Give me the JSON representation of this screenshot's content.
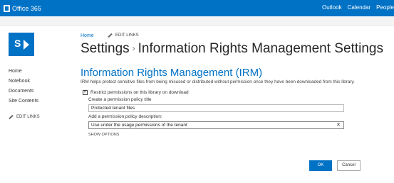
{
  "suite_bar": {
    "brand": "Office 365",
    "nav": [
      "Outlook",
      "Calendar",
      "People"
    ]
  },
  "breadcrumb": {
    "home": "Home",
    "edit_links": "EDIT LINKS"
  },
  "page_title": {
    "parent": "Settings",
    "separator": "›",
    "current": "Information Rights Management Settings"
  },
  "left_nav": {
    "items": [
      "Home",
      "Notebook",
      "Documents",
      "Site Contents"
    ],
    "edit_links": "EDIT LINKS"
  },
  "irm": {
    "heading": "Information Rights Management (IRM)",
    "description": "IRM helps protect sensitive files from being misused or distributed without permission once they have been downloaded from this library.",
    "restrict_label": "Restrict permissions on this library on download",
    "restrict_checked": true,
    "title_label": "Create a permission policy title",
    "title_value": "Protected tenant files",
    "desc_label": "Add a permission policy description:",
    "desc_value": "Use under the usage permissions of the tenant",
    "show_options": "SHOW OPTIONS"
  },
  "buttons": {
    "ok": "OK",
    "cancel": "Cancel"
  },
  "colors": {
    "accent": "#0072c6"
  }
}
